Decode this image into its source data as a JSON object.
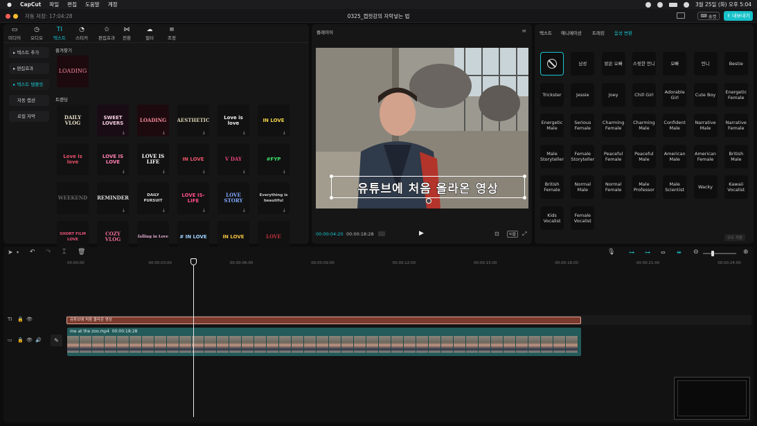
{
  "menubar": {
    "app": "CapCut",
    "items": [
      "파일",
      "편집",
      "도움말",
      "계정"
    ],
    "clock": "3월 25일 (화) 오후 5:04"
  },
  "window": {
    "autosave": "자동 저장: 17:04:28",
    "title": "0325_캡컷강의 자막넣는 법",
    "shortcut_label": "숏컷",
    "export_label": "내보내기",
    "accent": "#18c7d0"
  },
  "toolbar": {
    "items": [
      {
        "label": "미디어",
        "icon": "media-icon"
      },
      {
        "label": "오디오",
        "icon": "audio-icon"
      },
      {
        "label": "텍스트",
        "icon": "text-icon"
      },
      {
        "label": "스티커",
        "icon": "sticker-icon"
      },
      {
        "label": "편집효과",
        "icon": "effects-icon"
      },
      {
        "label": "전환",
        "icon": "transition-icon"
      },
      {
        "label": "필터",
        "icon": "filter-icon"
      },
      {
        "label": "조정",
        "icon": "adjust-icon"
      }
    ],
    "active": "텍스트"
  },
  "sidebar": {
    "items": [
      "▸ 텍스트 추가",
      "▸ 편집효과",
      "▸ 텍스트 템플릿",
      "자동 캡션",
      "로컬 자막"
    ]
  },
  "templates": {
    "favorites_label": "즐겨찾기",
    "trending_label": "트렌딩",
    "favorites": [
      "LOADING"
    ],
    "trending": [
      "DAILY VLOG",
      "SWEET LOVERS",
      "LOADING",
      "AESTHETIC",
      "Love is love",
      "IN LOVE",
      "Love is love",
      "LOVE IS LOVE",
      "LOVE IS LIFE",
      "IN LOVE",
      "V DAY",
      "#FYP",
      "WEEKEND",
      "REMINDER",
      "DAILY PURSUIT",
      "LOVE IS-LIFE",
      "LOVE STORY",
      "Everything is beautiful",
      "SHORT FILM LOVE",
      "COZY VLOG",
      "falling in Love",
      "# IN LOVE",
      "IN LOVE",
      "LOVE"
    ]
  },
  "player": {
    "title": "플레이어",
    "subtitle": "유튜브에 처음 올라온 영상",
    "current_time": "00:00:04:20",
    "total_time": "00:00:18:28",
    "ratio_label": "비율"
  },
  "right_panel": {
    "tabs": [
      "텍스트",
      "애니메이션",
      "트래킹",
      "음성 변환"
    ],
    "active_tab": "음성 변환",
    "voices": [
      "",
      "남성",
      "밝은 오빠",
      "스윗한 언니",
      "오빠",
      "언니",
      "Bestie",
      "Trickster",
      "Jessie",
      "Joey",
      "Chill Girl",
      "Adorable Girl",
      "Cute Boy",
      "Energetic Female",
      "Energetic Male",
      "Serious Female",
      "Charming Female",
      "Charming Male",
      "Confident Male",
      "Narrative Male",
      "Narrative Female",
      "Male Storyteller",
      "Female Storyteller",
      "Peaceful Female",
      "Peaceful Male",
      "American Male",
      "American Female",
      "British Male",
      "British Female",
      "Normal Male",
      "Normal Female",
      "Male Professor",
      "Male Scientist",
      "Wacky",
      "Kawaii Vocalist",
      "Kids Vocalist",
      "Female Vocalist"
    ],
    "apply_label": "모두 적용"
  },
  "timeline": {
    "ruler": [
      "00:00:00",
      "00:00:03:00",
      "00:00:06:00",
      "00:00:09:00",
      "00:00:12:00",
      "00:00:15:00",
      "00:00:18:00",
      "00:00:21:00",
      "00:00:24:00"
    ],
    "text_clip": "유튜브에 처음 올라온 영상",
    "video_clip_name": "me at the zoo.mp4",
    "video_clip_duration": "00:00:18:28"
  }
}
